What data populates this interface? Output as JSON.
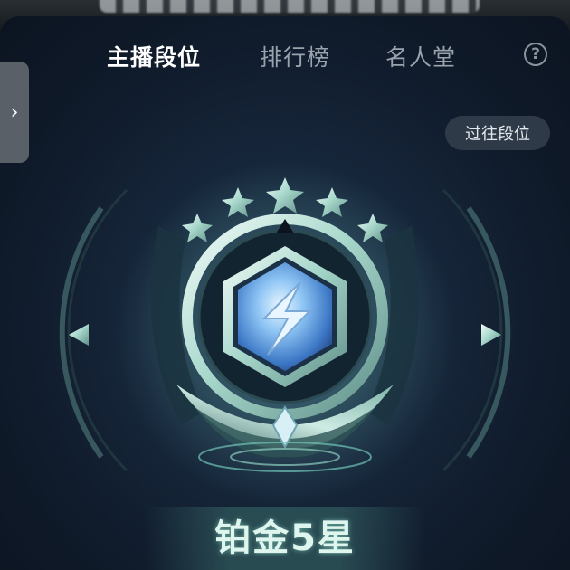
{
  "nav": {
    "tabs": [
      {
        "label": "主播段位",
        "active": true
      },
      {
        "label": "排行榜",
        "active": false
      },
      {
        "label": "名人堂",
        "active": false
      }
    ],
    "help_label": "?",
    "side_toggle_icon": "chevron-right-icon"
  },
  "actions": {
    "past_rank_label": "过往段位"
  },
  "rank": {
    "name": "铂金5星",
    "stars": 5,
    "badge_icon": "platinum-rank-badge-icon"
  },
  "colors": {
    "accent": "#9fe3d2",
    "panel_bg": "#0f1a2a",
    "active_tab": "#ffffff",
    "inactive_tab": "#9aa3ad"
  }
}
